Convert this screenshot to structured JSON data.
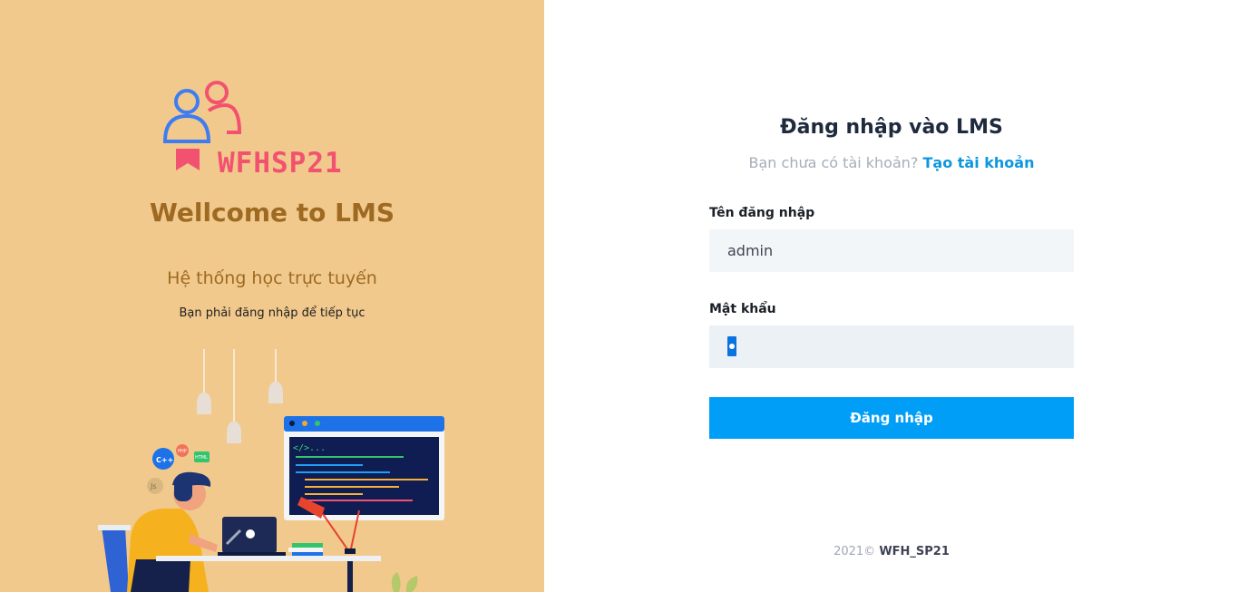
{
  "brand": {
    "name": "WFHSP21"
  },
  "left": {
    "welcome": "Wellcome to LMS",
    "subtitle": "Hệ thống học trực tuyến",
    "note": "Bạn phải đăng nhập để tiếp tục"
  },
  "form": {
    "title": "Đăng nhập vào LMS",
    "no_account": "Bạn chưa có tài khoản?",
    "create_link": "Tạo tài khoản",
    "username_label": "Tên đăng nhập",
    "username_value": "admin",
    "password_label": "Mật khẩu",
    "submit_label": "Đăng nhập"
  },
  "footer": {
    "year": "2021©",
    "brand": "WFH_SP21"
  },
  "colors": {
    "left_bg": "#f1c98d",
    "accent": "#009ef7",
    "brand_red": "#f25270",
    "welcome_text": "#9e6a22"
  },
  "icons": [
    "users-logo-icon",
    "bookmark-icon",
    "cpp-badge-icon",
    "php-badge-icon",
    "html-badge-icon",
    "js-badge-icon"
  ]
}
